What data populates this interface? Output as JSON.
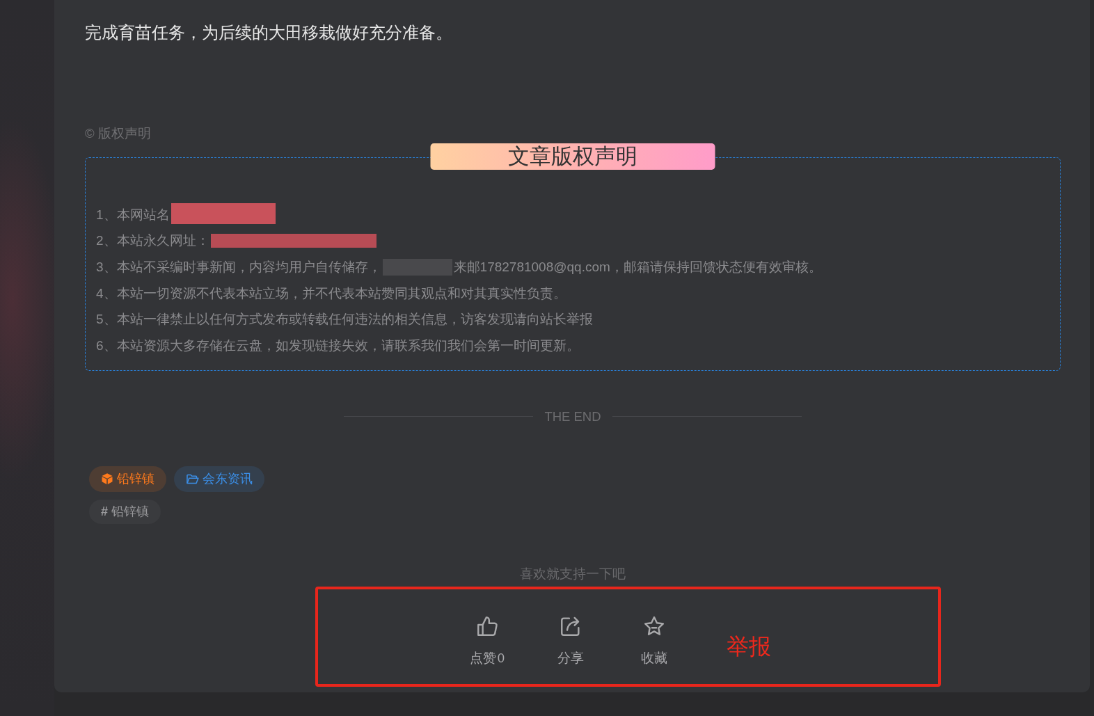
{
  "article": {
    "paragraph": "完成育苗任务，为后续的大田移栽做好充分准备。"
  },
  "copyright": {
    "label": "© 版权声明",
    "title": "文章版权声明",
    "items": [
      {
        "segments": [
          {
            "kind": "text",
            "text": "1、本网站名"
          },
          {
            "kind": "redacted",
            "color": "#c9525b"
          }
        ]
      },
      {
        "segments": [
          {
            "kind": "text",
            "text": "2、本站永久网址："
          },
          {
            "kind": "redacted",
            "color": "#b84c55"
          }
        ]
      },
      {
        "segments": [
          {
            "kind": "text",
            "text": "3、本站不采编时事新闻，内容均用户自传储存，"
          },
          {
            "kind": "redacted",
            "color": "#49494c"
          },
          {
            "kind": "text",
            "text": "来邮1782781008@qq.com，邮箱请保持回馈状态便有效审核。"
          }
        ]
      },
      {
        "segments": [
          {
            "kind": "text",
            "text": "4、本站一切资源不代表本站立场，并不代表本站赞同其观点和对其真实性负责。"
          }
        ]
      },
      {
        "segments": [
          {
            "kind": "text",
            "text": "5、本站一律禁止以任何方式发布或转载任何违法的相关信息，访客发现请向站长举报"
          }
        ]
      },
      {
        "segments": [
          {
            "kind": "text",
            "text": "6、本站资源大多存储在云盘，如发现链接失效，请联系我们我们会第一时间更新。"
          }
        ]
      }
    ]
  },
  "end_label": "THE END",
  "categories": [
    {
      "kind": "place",
      "label": "铅锌镇",
      "color": "#ff7a1c"
    },
    {
      "kind": "column",
      "label": "会东资讯",
      "color": "#3b8ee6"
    }
  ],
  "tags": [
    {
      "label": "**#** 铅锌镇"
    }
  ],
  "support": {
    "prompt": "喜欢就支持一下吧",
    "actions": [
      {
        "kind": "like",
        "label": "点赞",
        "count": "0"
      },
      {
        "kind": "share",
        "label": "分享"
      },
      {
        "kind": "favorite",
        "label": "收藏"
      }
    ],
    "report": "举报"
  }
}
